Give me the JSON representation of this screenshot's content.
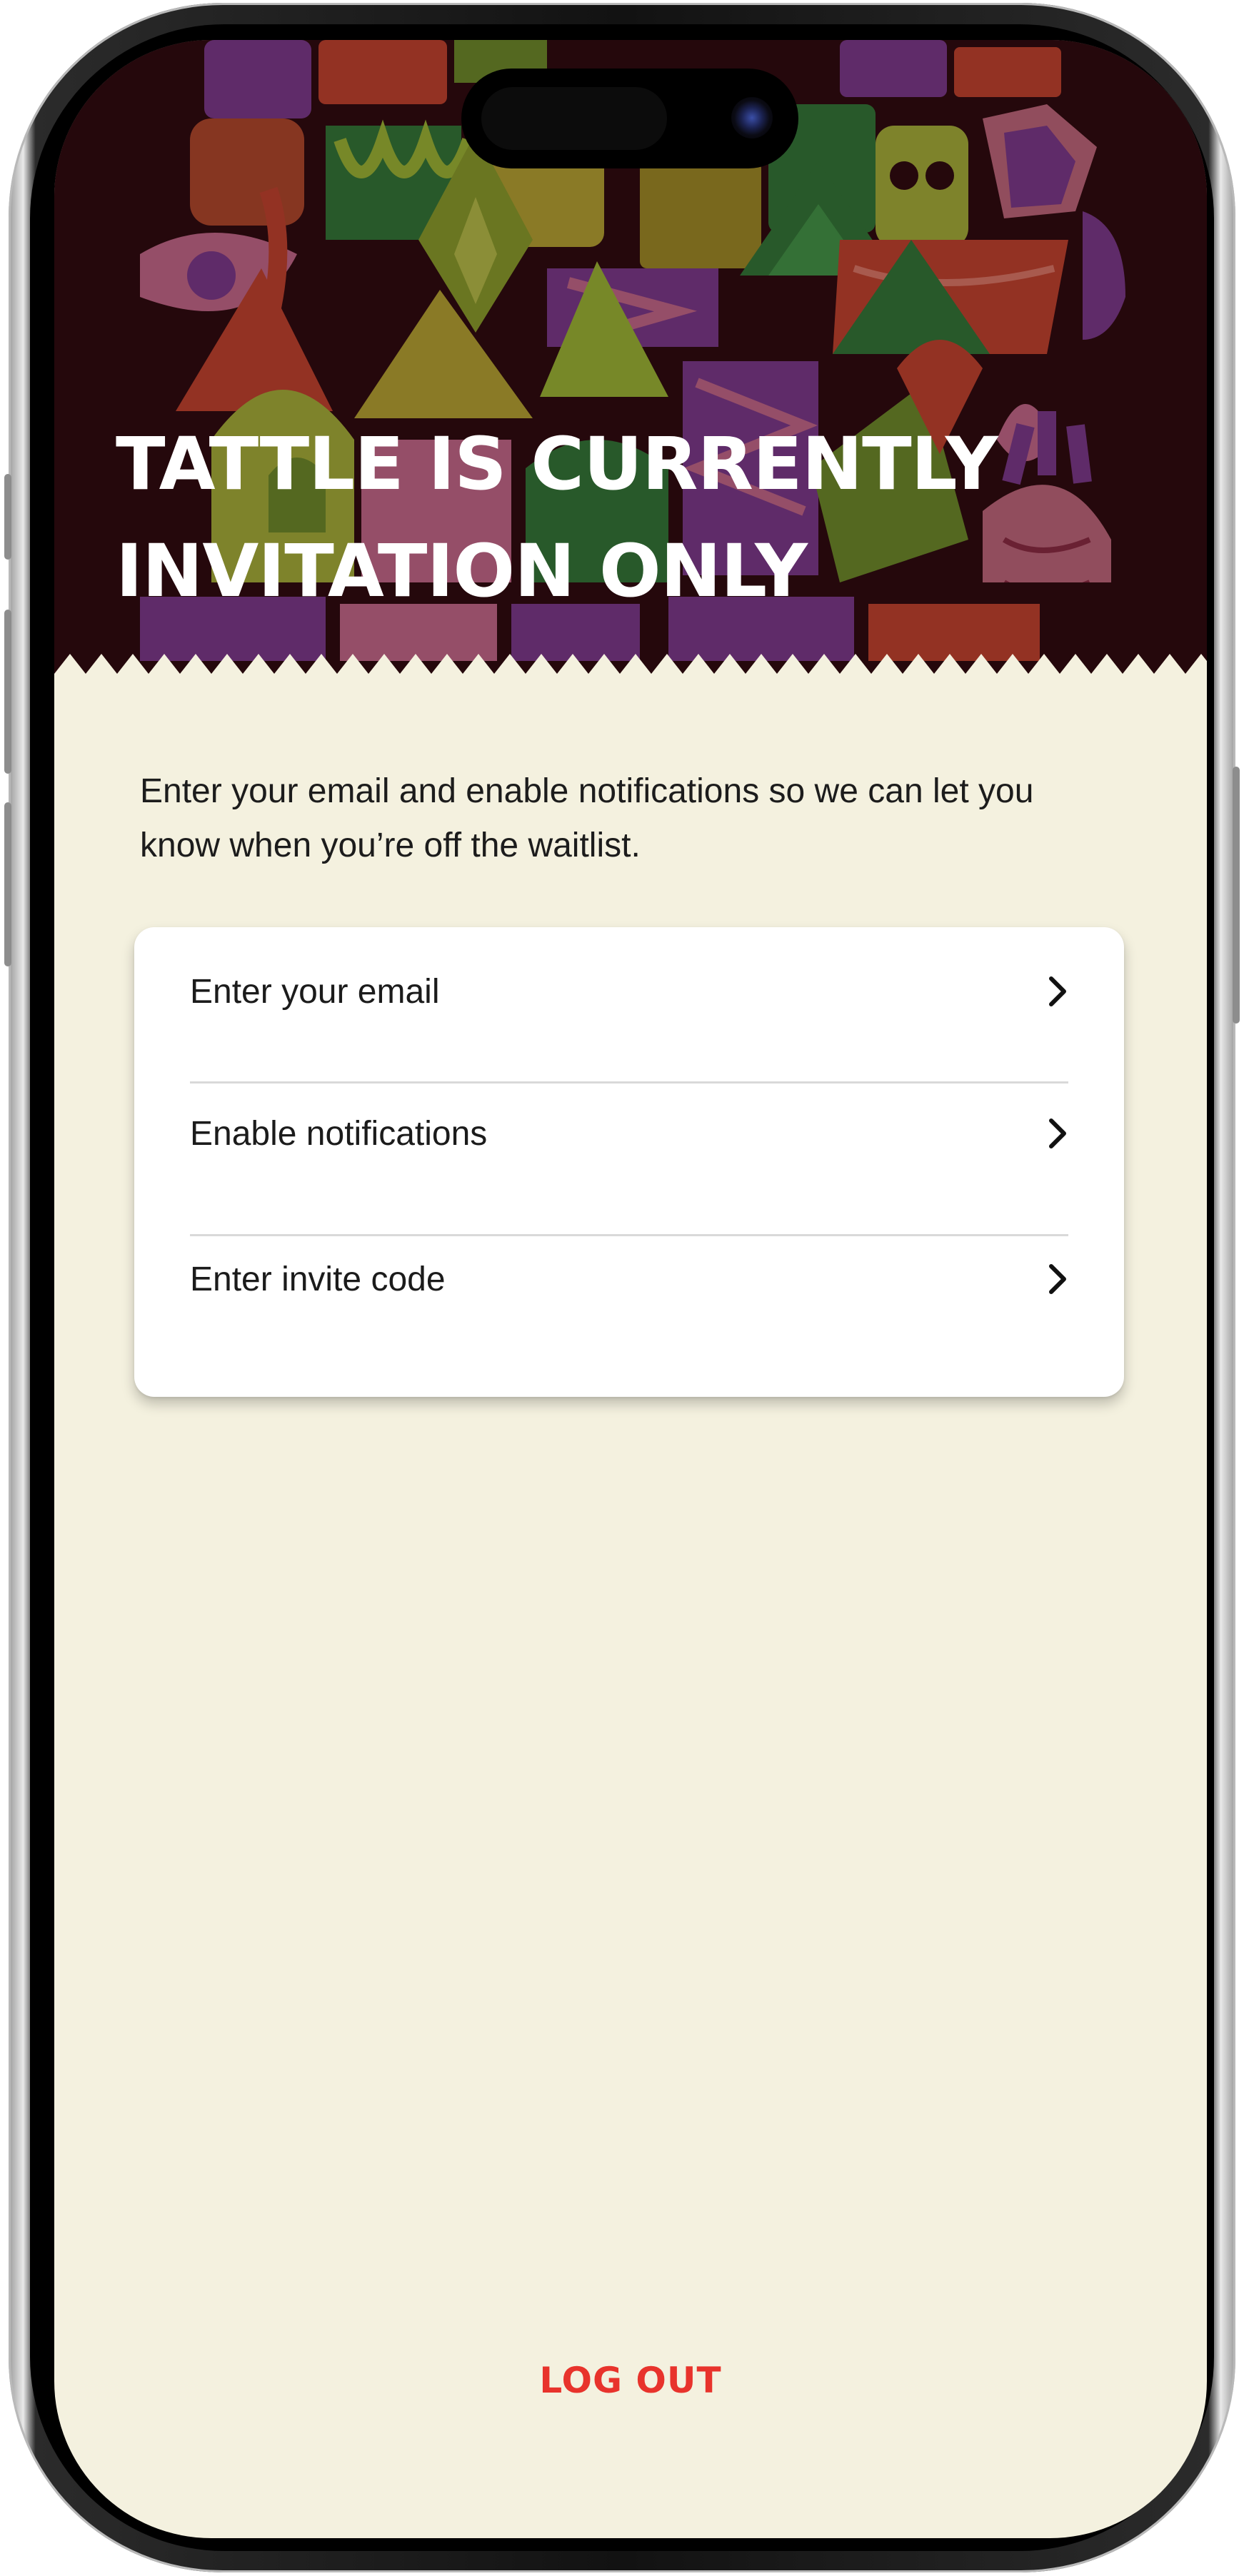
{
  "hero": {
    "title_line1": "TATTLE IS CURRENTLY",
    "title_line2": "INVITATION ONLY"
  },
  "intro_text": "Enter your email and enable notifications so we can let you know when you’re off the waitlist.",
  "options": [
    {
      "label": "Enter your email",
      "icon": "chevron-right-icon"
    },
    {
      "label": "Enable notifications",
      "icon": "chevron-right-icon"
    },
    {
      "label": "Enter invite code",
      "icon": "chevron-right-icon"
    }
  ],
  "logout_label": "LOG OUT",
  "colors": {
    "background": "#f4f1df",
    "hero_background": "#2a0a0f",
    "card": "#ffffff",
    "logout": "#e8332c",
    "text": "#1c1c1c"
  }
}
